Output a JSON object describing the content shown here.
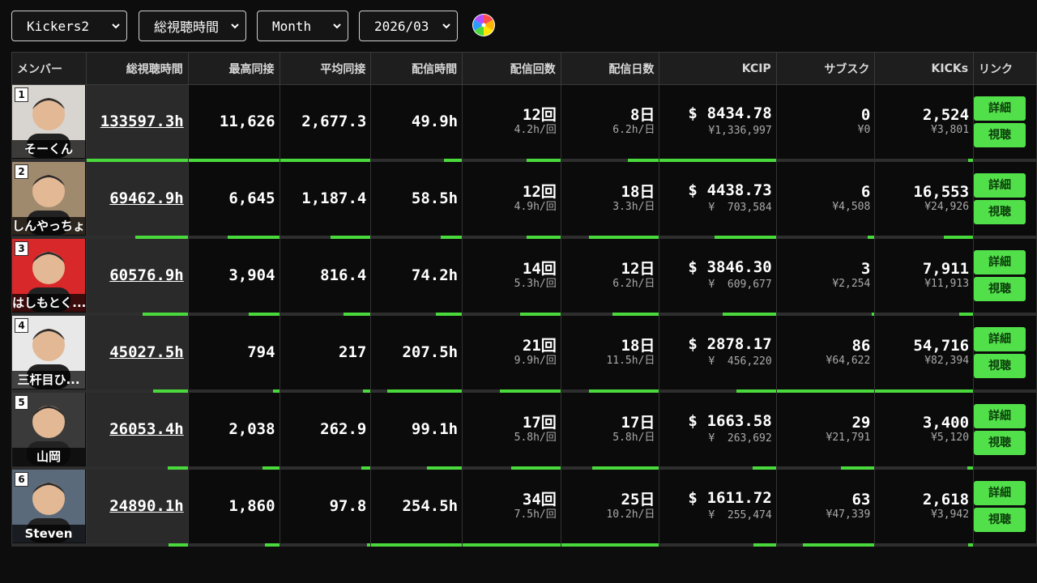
{
  "toolbar": {
    "group": "Kickers2",
    "metric": "総視聴時間",
    "period": "Month",
    "date": "2026/03"
  },
  "headers": [
    "メンバー",
    "総視聴時間",
    "最高同接",
    "平均同接",
    "配信時間",
    "配信回数",
    "配信日数",
    "KCIP",
    "サブスク",
    "KICKs",
    "リンク"
  ],
  "link_labels": {
    "detail": "詳細",
    "watch": "視聴"
  },
  "rows": [
    {
      "rank": "1",
      "name": "そーくん",
      "watch": "133597.3h",
      "peak": "11,626",
      "avg": "2,677.3",
      "stream_time": "49.9h",
      "count": "12回",
      "count_sub": "4.2h/回",
      "days": "8日",
      "days_sub": "6.2h/日",
      "kcip_cur": "$",
      "kcip": "8434.78",
      "kcip_yen_cur": "¥",
      "kcip_yen": "1,336,997",
      "subs": "0",
      "subs_sub": "¥0",
      "kicks": "2,524",
      "kicks_sub": "¥3,801",
      "fill": {
        "watch": 1.0,
        "peak": 1.0,
        "avg": 1.0,
        "stream": 0.2,
        "count": 0.35,
        "days": 0.32,
        "kcip": 1.0,
        "subs": 0.0,
        "kicks": 0.05
      },
      "avatar_bg": "#d8d4cf"
    },
    {
      "rank": "2",
      "name": "しんやっちょ",
      "watch": "69462.9h",
      "peak": "6,645",
      "avg": "1,187.4",
      "stream_time": "58.5h",
      "count": "12回",
      "count_sub": "4.9h/回",
      "days": "18日",
      "days_sub": "3.3h/日",
      "kcip_cur": "$",
      "kcip": "4438.73",
      "kcip_yen_cur": "¥",
      "kcip_yen": "703,584",
      "subs": "6",
      "subs_sub": "¥4,508",
      "kicks": "16,553",
      "kicks_sub": "¥24,926",
      "fill": {
        "watch": 0.52,
        "peak": 0.57,
        "avg": 0.44,
        "stream": 0.23,
        "count": 0.35,
        "days": 0.72,
        "kcip": 0.53,
        "subs": 0.07,
        "kicks": 0.3
      },
      "avatar_bg": "#a08a6e"
    },
    {
      "rank": "3",
      "name": "はしもとく...",
      "watch": "60576.9h",
      "peak": "3,904",
      "avg": "816.4",
      "stream_time": "74.2h",
      "count": "14回",
      "count_sub": "5.3h/回",
      "days": "12日",
      "days_sub": "6.2h/日",
      "kcip_cur": "$",
      "kcip": "3846.30",
      "kcip_yen_cur": "¥",
      "kcip_yen": "609,677",
      "subs": "3",
      "subs_sub": "¥2,254",
      "kicks": "7,911",
      "kicks_sub": "¥11,913",
      "fill": {
        "watch": 0.45,
        "peak": 0.34,
        "avg": 0.3,
        "stream": 0.29,
        "count": 0.41,
        "days": 0.48,
        "kcip": 0.46,
        "subs": 0.03,
        "kicks": 0.14
      },
      "avatar_bg": "#d8282a"
    },
    {
      "rank": "4",
      "name": "三杆目ひ...",
      "watch": "45027.5h",
      "peak": "794",
      "avg": "217",
      "stream_time": "207.5h",
      "count": "21回",
      "count_sub": "9.9h/回",
      "days": "18日",
      "days_sub": "11.5h/日",
      "kcip_cur": "$",
      "kcip": "2878.17",
      "kcip_yen_cur": "¥",
      "kcip_yen": "456,220",
      "subs": "86",
      "subs_sub": "¥64,622",
      "kicks": "54,716",
      "kicks_sub": "¥82,394",
      "fill": {
        "watch": 0.34,
        "peak": 0.07,
        "avg": 0.08,
        "stream": 0.82,
        "count": 0.62,
        "days": 0.72,
        "kcip": 0.34,
        "subs": 1.0,
        "kicks": 1.0
      },
      "avatar_bg": "#e8e8e8"
    },
    {
      "rank": "5",
      "name": "山岡",
      "watch": "26053.4h",
      "peak": "2,038",
      "avg": "262.9",
      "stream_time": "99.1h",
      "count": "17回",
      "count_sub": "5.8h/回",
      "days": "17日",
      "days_sub": "5.8h/日",
      "kcip_cur": "$",
      "kcip": "1663.58",
      "kcip_yen_cur": "¥",
      "kcip_yen": "263,692",
      "subs": "29",
      "subs_sub": "¥21,791",
      "kicks": "3,400",
      "kicks_sub": "¥5,120",
      "fill": {
        "watch": 0.2,
        "peak": 0.18,
        "avg": 0.1,
        "stream": 0.39,
        "count": 0.5,
        "days": 0.68,
        "kcip": 0.2,
        "subs": 0.34,
        "kicks": 0.06
      },
      "avatar_bg": "#3a3a3a"
    },
    {
      "rank": "6",
      "name": "Steven",
      "watch": "24890.1h",
      "peak": "1,860",
      "avg": "97.8",
      "stream_time": "254.5h",
      "count": "34回",
      "count_sub": "7.5h/回",
      "days": "25日",
      "days_sub": "10.2h/日",
      "kcip_cur": "$",
      "kcip": "1611.72",
      "kcip_yen_cur": "¥",
      "kcip_yen": "255,474",
      "subs": "63",
      "subs_sub": "¥47,339",
      "kicks": "2,618",
      "kicks_sub": "¥3,942",
      "fill": {
        "watch": 0.19,
        "peak": 0.16,
        "avg": 0.04,
        "stream": 1.0,
        "count": 1.0,
        "days": 1.0,
        "kcip": 0.19,
        "subs": 0.73,
        "kicks": 0.05
      },
      "avatar_bg": "#5a6a7a"
    }
  ],
  "colors": {
    "accent": "#4ad93c",
    "button": "#52e04a",
    "header_bg": "#1e1e1e",
    "watch_col_bg": "#2a2a2a"
  }
}
